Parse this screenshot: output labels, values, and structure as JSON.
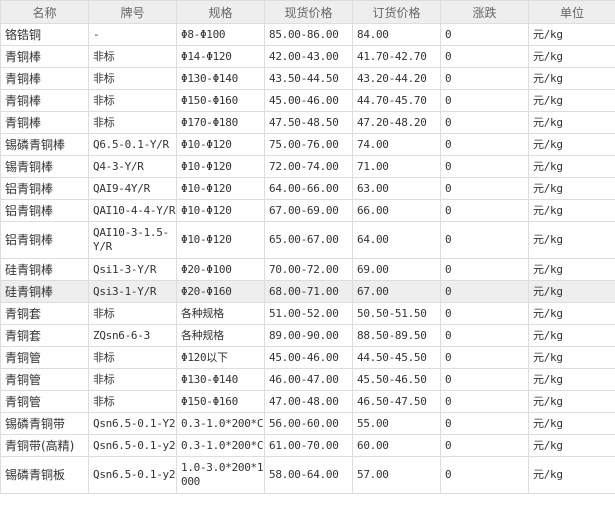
{
  "headers": [
    "名称",
    "牌号",
    "规格",
    "现货价格",
    "订货价格",
    "涨跌",
    "单位"
  ],
  "rows": [
    {
      "name": "铬锆铜",
      "grade": "-",
      "spec": "Φ8-Φ100",
      "spot": "85.00-86.00",
      "order": "84.00",
      "change": "0",
      "unit": "元/kg"
    },
    {
      "name": "青铜棒",
      "grade": "非标",
      "spec": "Φ14-Φ120",
      "spot": "42.00-43.00",
      "order": "41.70-42.70",
      "change": "0",
      "unit": "元/kg"
    },
    {
      "name": "青铜棒",
      "grade": "非标",
      "spec": "Φ130-Φ140",
      "spot": "43.50-44.50",
      "order": "43.20-44.20",
      "change": "0",
      "unit": "元/kg"
    },
    {
      "name": "青铜棒",
      "grade": "非标",
      "spec": "Φ150-Φ160",
      "spot": "45.00-46.00",
      "order": "44.70-45.70",
      "change": "0",
      "unit": "元/kg"
    },
    {
      "name": "青铜棒",
      "grade": "非标",
      "spec": "Φ170-Φ180",
      "spot": "47.50-48.50",
      "order": "47.20-48.20",
      "change": "0",
      "unit": "元/kg"
    },
    {
      "name": "锡磷青铜棒",
      "grade": "Q6.5-0.1-Y/R",
      "spec": "Φ10-Φ120",
      "spot": "75.00-76.00",
      "order": "74.00",
      "change": "0",
      "unit": "元/kg"
    },
    {
      "name": "锡青铜棒",
      "grade": "Q4-3-Y/R",
      "spec": "Φ10-Φ120",
      "spot": "72.00-74.00",
      "order": "71.00",
      "change": "0",
      "unit": "元/kg"
    },
    {
      "name": "铝青铜棒",
      "grade": "QAI9-4Y/R",
      "spec": "Φ10-Φ120",
      "spot": "64.00-66.00",
      "order": "63.00",
      "change": "0",
      "unit": "元/kg"
    },
    {
      "name": "铝青铜棒",
      "grade": "QAI10-4-4-Y/R",
      "spec": "Φ10-Φ120",
      "spot": "67.00-69.00",
      "order": "66.00",
      "change": "0",
      "unit": "元/kg"
    },
    {
      "name": "铝青铜棒",
      "grade": "QAI10-3-1.5-Y/R",
      "spec": "Φ10-Φ120",
      "spot": "65.00-67.00",
      "order": "64.00",
      "change": "0",
      "unit": "元/kg"
    },
    {
      "name": "硅青铜棒",
      "grade": "Qsi1-3-Y/R",
      "spec": "Φ20-Φ100",
      "spot": "70.00-72.00",
      "order": "69.00",
      "change": "0",
      "unit": "元/kg"
    },
    {
      "name": "硅青铜棒",
      "grade": "Qsi3-1-Y/R",
      "spec": "Φ20-Φ160",
      "spot": "68.00-71.00",
      "order": "67.00",
      "change": "0",
      "unit": "元/kg"
    },
    {
      "name": "青铜套",
      "grade": "非标",
      "spec": "各种规格",
      "spot": "51.00-52.00",
      "order": "50.50-51.50",
      "change": "0",
      "unit": "元/kg"
    },
    {
      "name": "青铜套",
      "grade": "ZQsn6-6-3",
      "spec": "各种规格",
      "spot": "89.00-90.00",
      "order": "88.50-89.50",
      "change": "0",
      "unit": "元/kg"
    },
    {
      "name": "青铜管",
      "grade": "非标",
      "spec": "Φ120以下",
      "spot": "45.00-46.00",
      "order": "44.50-45.50",
      "change": "0",
      "unit": "元/kg"
    },
    {
      "name": "青铜管",
      "grade": "非标",
      "spec": "Φ130-Φ140",
      "spot": "46.00-47.00",
      "order": "45.50-46.50",
      "change": "0",
      "unit": "元/kg"
    },
    {
      "name": "青铜管",
      "grade": "非标",
      "spec": "Φ150-Φ160",
      "spot": "47.00-48.00",
      "order": "46.50-47.50",
      "change": "0",
      "unit": "元/kg"
    },
    {
      "name": "锡磷青铜带",
      "grade": "Qsn6.5-0.1-Y2",
      "spec": "0.3-1.0*200*C",
      "spot": "56.00-60.00",
      "order": "55.00",
      "change": "0",
      "unit": "元/kg"
    },
    {
      "name": "青铜带(高精)",
      "grade": "Qsn6.5-0.1-y2",
      "spec": "0.3-1.0*200*C",
      "spot": "61.00-70.00",
      "order": "60.00",
      "change": "0",
      "unit": "元/kg"
    },
    {
      "name": "锡磷青铜板",
      "grade": "Qsn6.5-0.1-y2",
      "spec": "1.0-3.0*200*1000",
      "spot": "58.00-64.00",
      "order": "57.00",
      "change": "0",
      "unit": "元/kg"
    }
  ]
}
